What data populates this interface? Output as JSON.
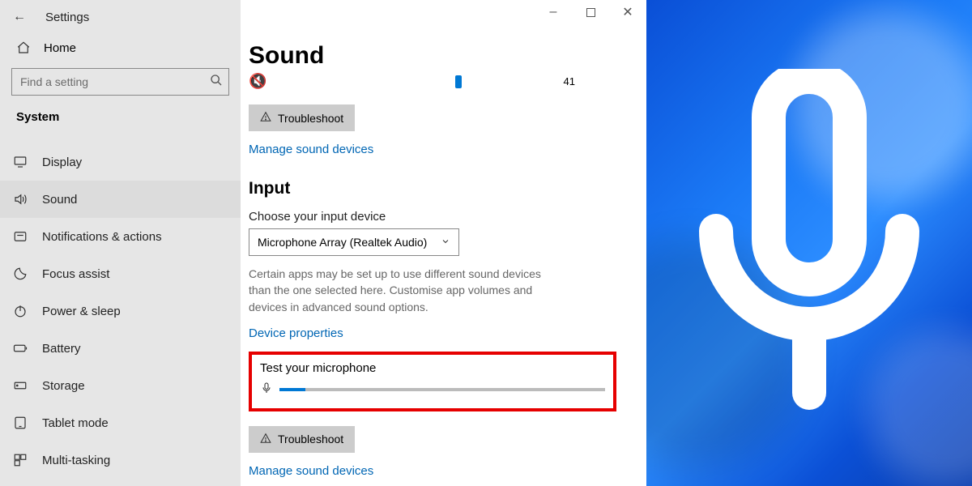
{
  "app": {
    "title": "Settings"
  },
  "sidebar": {
    "home": "Home",
    "search_placeholder": "Find a setting",
    "category": "System",
    "items": [
      {
        "label": "Display"
      },
      {
        "label": "Sound"
      },
      {
        "label": "Notifications & actions"
      },
      {
        "label": "Focus assist"
      },
      {
        "label": "Power & sleep"
      },
      {
        "label": "Battery"
      },
      {
        "label": "Storage"
      },
      {
        "label": "Tablet mode"
      },
      {
        "label": "Multi-tasking"
      }
    ],
    "active_index": 1
  },
  "main": {
    "heading": "Sound",
    "volume_value": "41",
    "troubleshoot1": "Troubleshoot",
    "manage1": "Manage sound devices",
    "input_heading": "Input",
    "choose_label": "Choose your input device",
    "input_device": "Microphone Array (Realtek Audio)",
    "desc": "Certain apps may be set up to use different sound devices than the one selected here. Customise app volumes and devices in advanced sound options.",
    "device_props": "Device properties",
    "test_label": "Test your microphone",
    "mic_level_percent": 8,
    "troubleshoot2": "Troubleshoot",
    "manage2": "Manage sound devices"
  }
}
